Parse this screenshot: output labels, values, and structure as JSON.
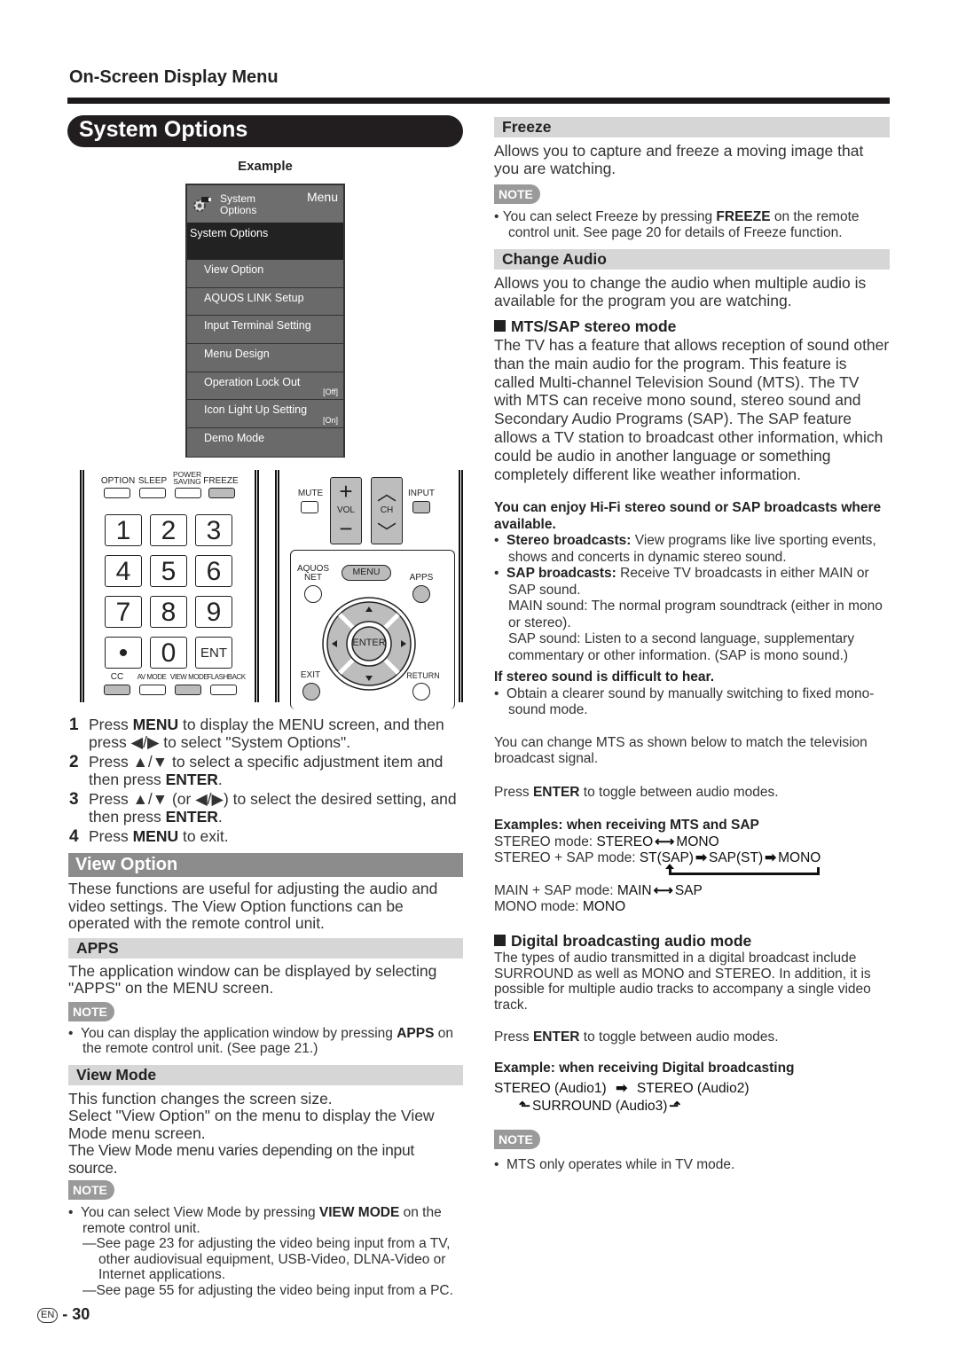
{
  "header": {
    "section": "On-Screen Display Menu",
    "title": "System Options",
    "example_label": "Example"
  },
  "osd": {
    "head_title": "System Options",
    "head_menu": "Menu",
    "current": "System Options",
    "items": [
      {
        "label": "View Option",
        "value": ""
      },
      {
        "label": "AQUOS LINK Setup",
        "value": ""
      },
      {
        "label": "Input Terminal Setting",
        "value": ""
      },
      {
        "label": "Menu Design",
        "value": ""
      },
      {
        "label": "Operation Lock Out",
        "value": "[Off]"
      },
      {
        "label": "Icon Light Up Setting",
        "value": "[On]"
      },
      {
        "label": "Demo Mode",
        "value": ""
      }
    ]
  },
  "remote": {
    "top_buttons": [
      "OPTION",
      "SLEEP",
      "POWER SAVING",
      "FREEZE"
    ],
    "number_keys": [
      "1",
      "2",
      "3",
      "4",
      "5",
      "6",
      "7",
      "8",
      "9",
      "•",
      "0",
      "ENT"
    ],
    "bottom_buttons": [
      "CC",
      "AV MODE",
      "VIEW MODE",
      "FLASHBACK"
    ],
    "mute": "MUTE",
    "vol": "VOL",
    "ch": "CH",
    "input": "INPUT",
    "aquos_net": "AQUOS NET",
    "menu": "MENU",
    "apps": "APPS",
    "enter": "ENTER",
    "exit": "EXIT",
    "return": "RETURN"
  },
  "steps": [
    {
      "num": "1",
      "a": "Press ",
      "b": "MENU",
      "c": " to display the MENU screen, and then press ◀/▶ to select \"System Options\"."
    },
    {
      "num": "2",
      "a": "Press ▲/▼ to select a specific adjustment item and then press ",
      "b": "ENTER",
      "c": "."
    },
    {
      "num": "3",
      "a": "Press ▲/▼ (or ◀/▶) to select the desired setting, and then press ",
      "b": "ENTER",
      "c": "."
    },
    {
      "num": "4",
      "a": "Press ",
      "b": "MENU",
      "c": " to exit."
    }
  ],
  "view_option": {
    "title": "View Option",
    "body": "These functions are useful for adjusting the audio and video settings. The View Option functions can be operated with the remote control unit."
  },
  "apps": {
    "title": "APPS",
    "body": "The application window can be displayed by selecting \"APPS\" on the MENU screen.",
    "note_label": "NOTE",
    "note_a": "You can display the application window by pressing ",
    "note_b": "APPS",
    "note_c": " on the remote control unit. (See page 21.)"
  },
  "view_mode": {
    "title": "View Mode",
    "line1": "This function changes the screen size.",
    "line2": "Select \"View Option\" on the menu to display the View Mode menu screen.",
    "line3": "The View Mode menu varies depending on the input source.",
    "note_label": "NOTE",
    "note_a": "You can select View Mode by pressing ",
    "note_b": "VIEW MODE",
    "note_c": " on the remote control unit.",
    "dash1": "See page 23 for adjusting the video being input from a TV, other audiovisual equipment, USB-Video, DLNA-Video or Internet applications.",
    "dash2": "See page 55 for adjusting the video being input from a PC."
  },
  "freeze": {
    "title": "Freeze",
    "body": "Allows you to capture and freeze a moving image that you are watching.",
    "note_label": "NOTE",
    "note_a": "You can select Freeze by pressing ",
    "note_b": "FREEZE",
    "note_c": " on the remote control unit. See page 20 for details of Freeze function."
  },
  "change_audio": {
    "title": "Change Audio",
    "body": "Allows you to change the audio when multiple audio is available for the program you are watching.",
    "mts_title": "MTS/SAP stereo mode",
    "mts_body": "The TV has a feature that allows reception of sound other than the main audio for the program. This feature is called Multi-channel Television Sound (MTS). The TV with MTS can receive mono sound, stereo sound and Secondary Audio Programs (SAP). The SAP feature allows a TV station to broadcast other information, which could be audio in another language or something completely different like weather information.",
    "hifi_head": "You can enjoy Hi-Fi stereo sound or SAP broadcasts where available.",
    "stereo_b": "Stereo broadcasts:",
    "stereo_t": " View programs like live sporting events, shows and concerts in dynamic stereo sound.",
    "sap_b": "SAP broadcasts:",
    "sap_t": " Receive TV broadcasts in either MAIN or SAP sound.",
    "main_sound": "MAIN sound: The normal program soundtrack (either in mono or stereo).",
    "sap_sound": "SAP sound: Listen to a second language, supplementary commentary or other information. (SAP is mono sound.)",
    "difficult_head": "If stereo sound is difficult to hear.",
    "difficult_item": "Obtain a clearer sound by manually switching to fixed mono-sound mode.",
    "change_mts": "You can change MTS as shown below to match the television broadcast signal.",
    "press_a": "Press ",
    "press_b": "ENTER",
    "press_c": " to toggle between audio modes.",
    "examples_head": "Examples: when receiving MTS and SAP",
    "ex1_label": "STEREO mode: ",
    "ex1_a": "STEREO",
    "ex1_b": "MONO",
    "ex2_label": "STEREO + SAP mode: ",
    "ex2_a": "ST(SAP)",
    "ex2_b": "SAP(ST)",
    "ex2_c": "MONO",
    "ex3_label": "MAIN + SAP mode: ",
    "ex3_a": "MAIN",
    "ex3_b": "SAP",
    "ex4_label": "MONO mode: ",
    "ex4_a": "MONO",
    "digital_title": "Digital broadcasting audio mode",
    "digital_body": "The types of audio transmitted in a digital broadcast include SURROUND as well as MONO and STEREO. In addition, it is possible for multiple audio tracks to accompany a single video track.",
    "digital_example_head": "Example: when receiving Digital broadcasting",
    "d1": "STEREO (Audio1)",
    "d2": "STEREO (Audio2)",
    "d3": "SURROUND (Audio3)",
    "note_label": "NOTE",
    "note": "MTS only operates while in TV mode."
  },
  "footer": {
    "lang": "EN",
    "page": "30"
  }
}
